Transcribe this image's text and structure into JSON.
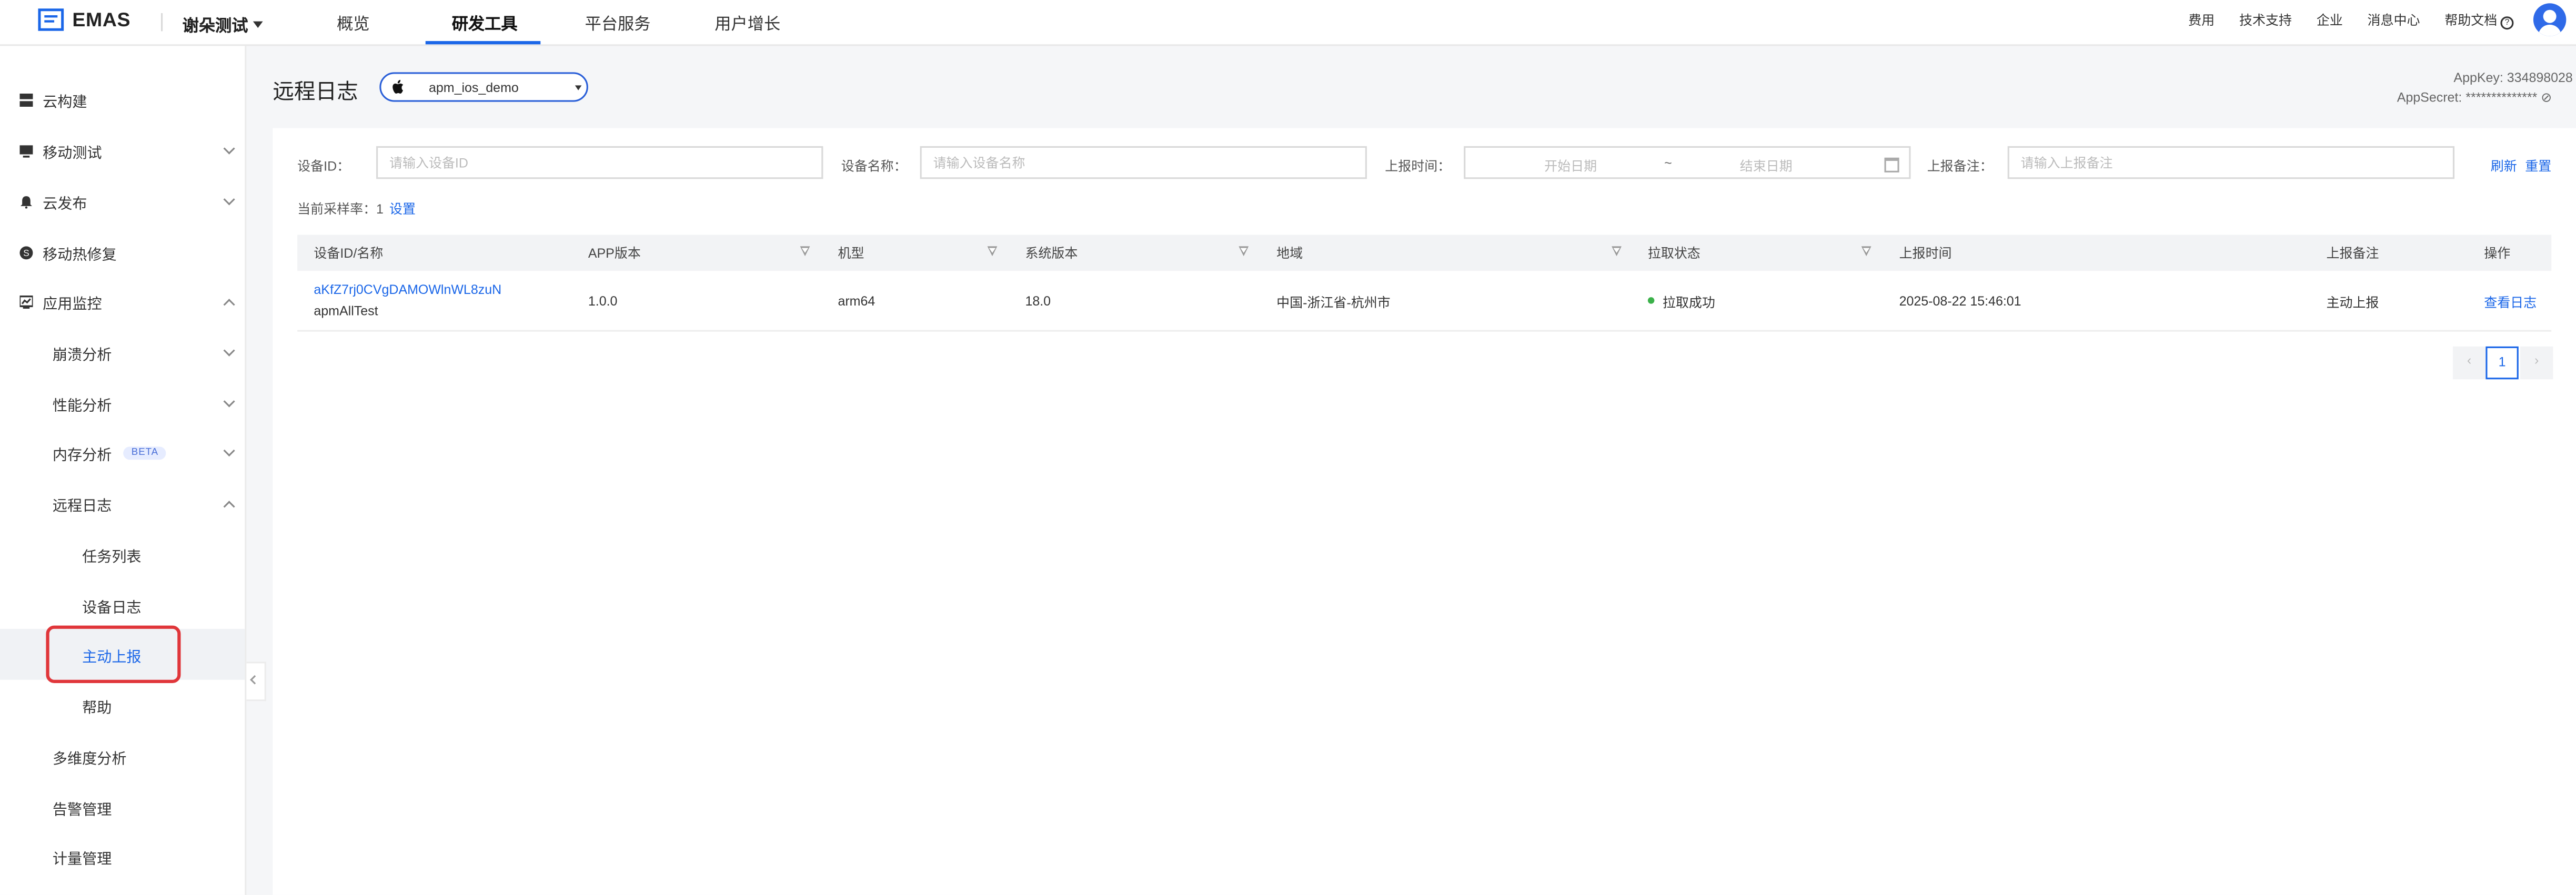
{
  "header": {
    "logo_text": "EMAS",
    "app_name": "谢朵测试",
    "tabs": [
      "概览",
      "研发工具",
      "平台服务",
      "用户增长"
    ],
    "links": [
      "费用",
      "技术支持",
      "企业",
      "消息中心",
      "帮助文档"
    ]
  },
  "sidebar": {
    "items": [
      {
        "label": "云构建",
        "icon": "server-icon"
      },
      {
        "label": "移动测试",
        "icon": "monitor-icon"
      },
      {
        "label": "云发布",
        "icon": "bell-icon"
      },
      {
        "label": "移动热修复",
        "icon": "hotfix-icon"
      },
      {
        "label": "应用监控",
        "icon": "chart-monitor-icon"
      }
    ],
    "sub_items": [
      "崩溃分析",
      "性能分析",
      "内存分析",
      "远程日志",
      "多维度分析",
      "告警管理",
      "计量管理"
    ],
    "beta_badge": "BETA",
    "remote_children": [
      "任务列表",
      "设备日志",
      "主动上报",
      "帮助"
    ]
  },
  "page": {
    "title": "远程日志",
    "app_select": "apm_ios_demo",
    "appkey": "AppKey: 334898028",
    "appsecret": "AppSecret: ************** ⊘"
  },
  "filters": {
    "device_id_label": "设备ID：",
    "device_id_placeholder": "请输入设备ID",
    "device_name_label": "设备名称：",
    "device_name_placeholder": "请输入设备名称",
    "report_time_label": "上报时间：",
    "start_date": "开始日期",
    "range_sep": "~",
    "end_date": "结束日期",
    "note_label": "上报备注：",
    "note_placeholder": "请输入上报备注",
    "refresh": "刷新",
    "reset": "重置"
  },
  "sampling": {
    "text": "当前采样率：1",
    "set": "设置"
  },
  "table": {
    "columns": [
      "设备ID/名称",
      "APP版本",
      "机型",
      "系统版本",
      "地域",
      "拉取状态",
      "上报时间",
      "上报备注",
      "操作"
    ],
    "rows": [
      {
        "device_id": "aKfZ7rj0CVgDAMOWlnWL8zuN",
        "device_name": "apmAllTest",
        "app_version": "1.0.0",
        "model": "arm64",
        "os_version": "18.0",
        "region": "中国-浙江省-杭州市",
        "status": "拉取成功",
        "time": "2025-08-22 15:46:01",
        "note": "主动上报",
        "action": "查看日志"
      }
    ]
  },
  "pagination": {
    "current": "1",
    "prev": "‹",
    "next": "›"
  },
  "colors": {
    "accent": "#1a66e8",
    "success": "#3bb14a",
    "highlight": "#e0363a"
  }
}
